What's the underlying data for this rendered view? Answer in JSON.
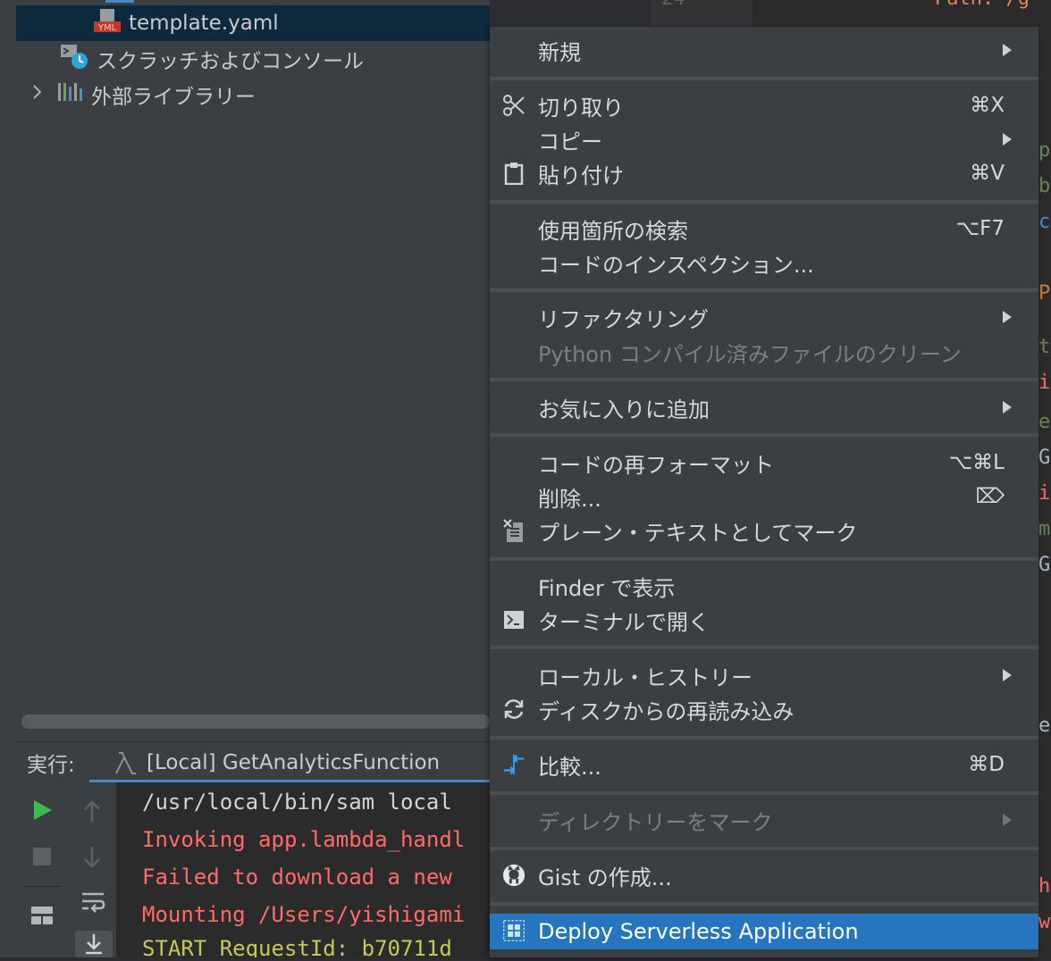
{
  "project_tree": {
    "items": [
      {
        "label": "template.yaml",
        "icon": "yaml-file-icon",
        "selected": true
      },
      {
        "label": "スクラッチおよびコンソール",
        "icon": "scratches-icon"
      },
      {
        "label": "外部ライブラリー",
        "icon": "library-icon",
        "expandable": true
      }
    ]
  },
  "run_panel": {
    "label": "実行:",
    "tab_label": "[Local] GetAnalyticsFunction",
    "console_lines": [
      {
        "text": "/usr/local/bin/sam local",
        "color": "#d4d4d4"
      },
      {
        "text": "Invoking app.lambda_handl",
        "color": "#ff6b68"
      },
      {
        "text": "Failed to download a new",
        "color": "#ff6b68"
      },
      {
        "text": "Mounting /Users/yishigami",
        "color": "#ff6b68"
      },
      {
        "text": "START RequestId: b70711d",
        "color": "#c7c75a"
      }
    ]
  },
  "editor": {
    "line_number": "24",
    "text_fragment": "Path: /g"
  },
  "context_menu": {
    "items": [
      {
        "label": "新規",
        "submenu": true
      },
      {
        "label": "切り取り",
        "shortcut": "⌘X",
        "icon": "scissors-icon"
      },
      {
        "label": "コピー",
        "submenu": true
      },
      {
        "label": "貼り付け",
        "shortcut": "⌘V",
        "icon": "clipboard-icon"
      },
      {
        "label": "使用箇所の検索",
        "shortcut": "⌥F7"
      },
      {
        "label": "コードのインスペクション..."
      },
      {
        "label": "リファクタリング",
        "submenu": true
      },
      {
        "label": "Python コンパイル済みファイルのクリーン",
        "disabled": true
      },
      {
        "label": "お気に入りに追加",
        "submenu": true
      },
      {
        "label": "コードの再フォーマット",
        "shortcut": "⌥⌘L"
      },
      {
        "label": "削除...",
        "shortcut": "⌦"
      },
      {
        "label": "プレーン・テキストとしてマーク",
        "icon": "plain-text-icon"
      },
      {
        "label": "Finder で表示"
      },
      {
        "label": "ターミナルで開く",
        "icon": "terminal-icon"
      },
      {
        "label": "ローカル・ヒストリー",
        "submenu": true
      },
      {
        "label": "ディスクからの再読み込み",
        "icon": "reload-icon"
      },
      {
        "label": "比較...",
        "shortcut": "⌘D",
        "icon": "compare-icon"
      },
      {
        "label": "ディレクトリーをマーク",
        "submenu": true,
        "disabled": true
      },
      {
        "label": "Gist の作成...",
        "icon": "github-icon"
      },
      {
        "label": "Deploy Serverless Application",
        "icon": "serverless-deploy-icon",
        "highlighted": true
      }
    ]
  },
  "colors": {
    "menu_bg": "#3c3f41",
    "highlight": "#2675bf",
    "selection": "#0d293e",
    "error_text": "#ff6b68"
  }
}
